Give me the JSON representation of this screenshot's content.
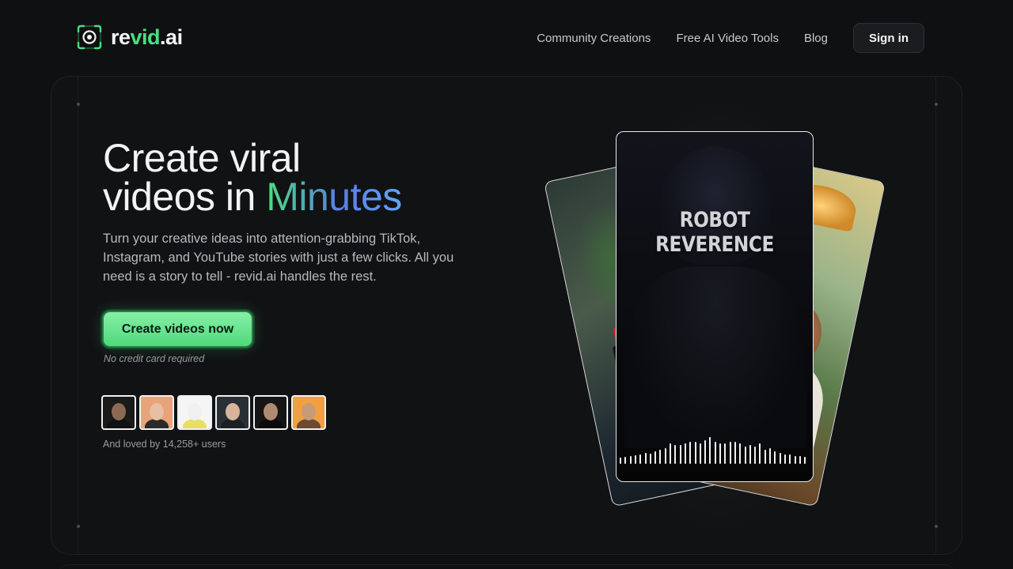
{
  "header": {
    "brand": {
      "prefix": "re",
      "highlight": "vid",
      "suffix": ".ai"
    },
    "nav": [
      {
        "label": "Community Creations"
      },
      {
        "label": "Free AI Video Tools"
      },
      {
        "label": "Blog"
      }
    ],
    "signin_label": "Sign in"
  },
  "hero": {
    "headline_line1": "Create viral",
    "headline_line2_prefix": "videos in ",
    "headline_line2_highlight": "Minutes",
    "subtext": "Turn your creative ideas into attention-grabbing TikTok, Instagram, and YouTube stories with just a few clicks. All you need is a story to tell - revid.ai handles the rest.",
    "cta_label": "Create videos now",
    "cta_note": "No credit card required",
    "social_proof": "And loved by 14,258+ users"
  },
  "avatars": [
    {
      "bg": "#1a1a1a",
      "skin": "#8a6a55",
      "shirt": "#111111"
    },
    {
      "bg": "#e8a37a",
      "skin": "#e6c0a0",
      "shirt": "#2a2a2a"
    },
    {
      "bg": "#f5f5f5",
      "skin": "#f0f0f0",
      "shirt": "#e8e060"
    },
    {
      "bg": "#2a2f36",
      "skin": "#d8b49a",
      "shirt": "#1c1f24"
    },
    {
      "bg": "#151515",
      "skin": "#b08a70",
      "shirt": "#0b0b0b"
    },
    {
      "bg": "#f0a040",
      "skin": "#c89a78",
      "shirt": "#6a4a30"
    }
  ],
  "video_cards": {
    "center_title": "ROBOT REVERENCE"
  },
  "colors": {
    "accent_green": "#4ade80",
    "background": "#0f1012"
  }
}
